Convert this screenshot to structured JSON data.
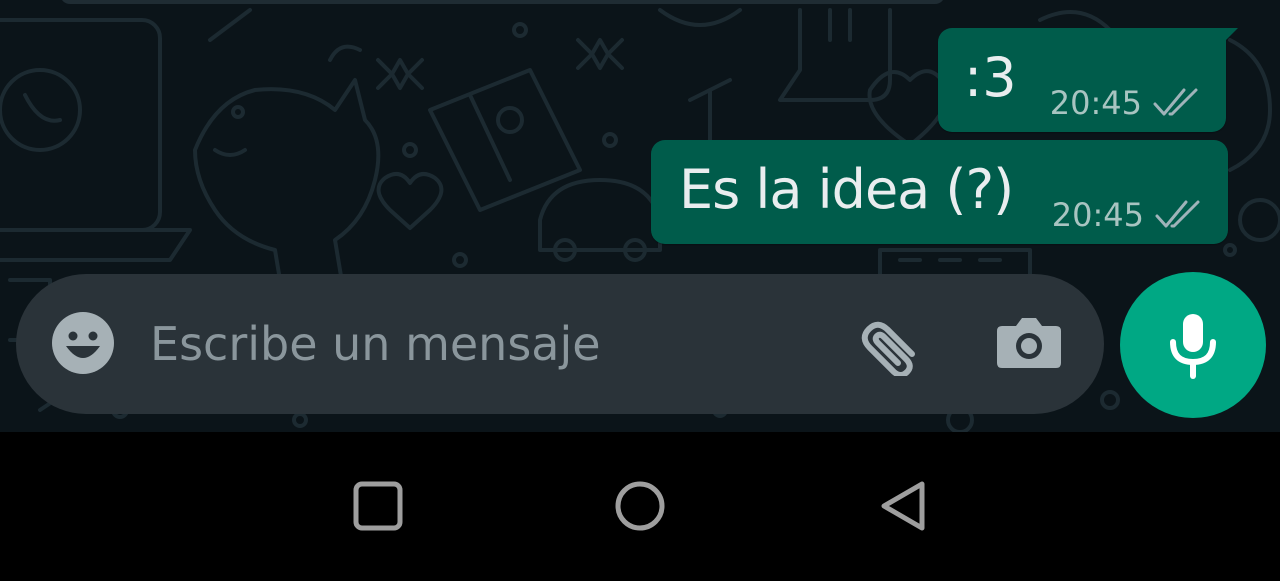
{
  "messages": [
    {
      "text": ":3",
      "time": "20:45",
      "status": "read"
    },
    {
      "text": "Es la idea (?)",
      "time": "20:45",
      "status": "read"
    }
  ],
  "composer": {
    "placeholder": "Escribe un mensaje",
    "emoji_icon": "emoji-icon",
    "attach_icon": "paperclip-icon",
    "camera_icon": "camera-icon"
  },
  "mic_button": {
    "icon": "microphone-icon"
  },
  "navbar": {
    "recents_icon": "square-icon",
    "home_icon": "circle-icon",
    "back_icon": "triangle-back-icon"
  },
  "colors": {
    "chat_background": "#0b1419",
    "outgoing_bubble": "#005c4b",
    "composer_background": "#2a3339",
    "accent": "#00a884",
    "navbar_background": "#000000"
  }
}
